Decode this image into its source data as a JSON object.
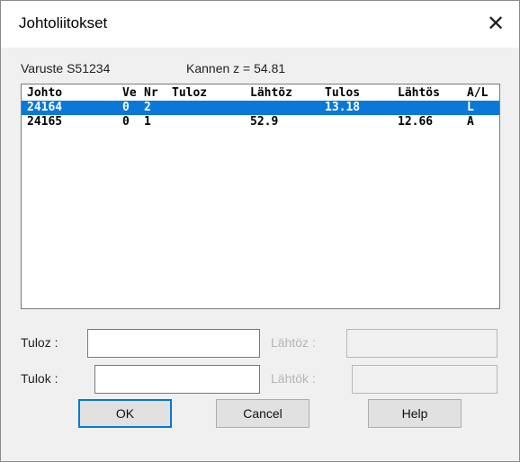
{
  "window": {
    "title": "Johtoliitokset",
    "close_glyph": "✕"
  },
  "info": {
    "varuste": "Varuste  S51234",
    "kannen": "Kannen z = 54.81"
  },
  "table": {
    "headers": [
      "Johto",
      "Ve",
      "Nr",
      "Tuloz",
      "Lähtöz",
      "Tulos",
      "Lähtös",
      "A/L"
    ],
    "rows": [
      {
        "johto": "24164",
        "ve": "0",
        "nr": "2",
        "tuloz": "",
        "lahtoz": "",
        "tulos": "13.18",
        "lahtos": "",
        "al": "L",
        "selected": true
      },
      {
        "johto": "24165",
        "ve": "0",
        "nr": "1",
        "tuloz": "",
        "lahtoz": "52.9",
        "tulos": "",
        "lahtos": "12.66",
        "al": "A",
        "selected": false
      }
    ]
  },
  "fields": {
    "tuloz_label": "Tuloz :",
    "tuloz_value": "",
    "lahtoz_label": "Lähtöz :",
    "lahtoz_value": "",
    "tulok_label": "Tulok  :",
    "tulok_value": "",
    "lahtok_label": "Lähtök :",
    "lahtok_value": ""
  },
  "buttons": {
    "ok": "OK",
    "cancel": "Cancel",
    "help": "Help"
  },
  "colors": {
    "selection": "#0a78d7",
    "default_button_border": "#0078d7"
  }
}
